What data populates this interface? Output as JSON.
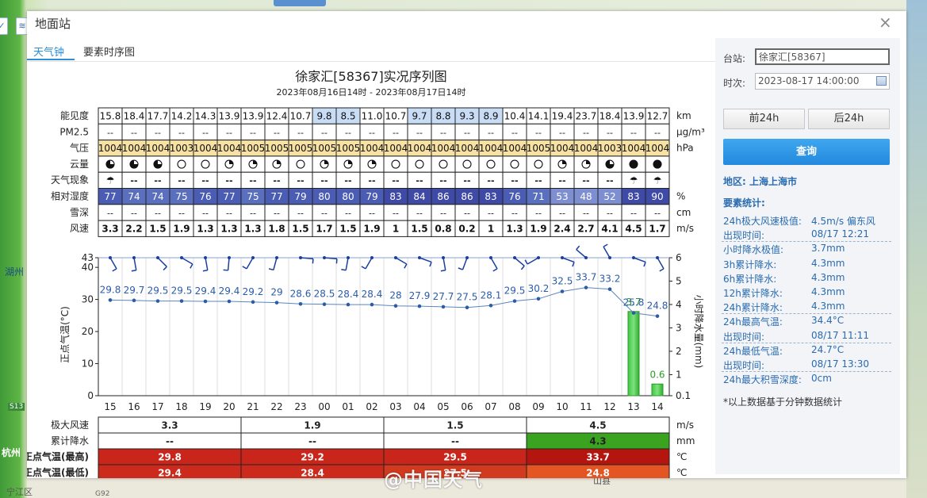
{
  "dialog": {
    "title": "地面站",
    "close": "×"
  },
  "tabs": [
    "天气钟",
    "要素时序图"
  ],
  "chart": {
    "title": "徐家汇[58367]实况序列图",
    "subtitle": "2023年08月16日14时 - 2023年08月17日14时"
  },
  "hours": [
    "15",
    "16",
    "17",
    "18",
    "19",
    "20",
    "21",
    "22",
    "23",
    "00",
    "01",
    "02",
    "03",
    "04",
    "05",
    "06",
    "07",
    "08",
    "09",
    "10",
    "11",
    "12",
    "13",
    "14"
  ],
  "rows": [
    {
      "label": "能见度",
      "unit": "km",
      "values": [
        "15.8",
        "18.4",
        "17.7",
        "14.2",
        "14.3",
        "13.9",
        "13.9",
        "12.4",
        "10.7",
        "9.8",
        "8.5",
        "11.0",
        "10.7",
        "9.7",
        "8.8",
        "9.3",
        "8.9",
        "10.4",
        "14.1",
        "19.4",
        "23.7",
        "18.4",
        "13.9",
        "12.7"
      ],
      "colors": [
        "#fff",
        "#fff",
        "#fff",
        "#fff",
        "#fff",
        "#fff",
        "#fff",
        "#fff",
        "#fff",
        "#c9dcf5",
        "#c9dcf5",
        "#fff",
        "#fff",
        "#c9dcf5",
        "#c9dcf5",
        "#c9dcf5",
        "#c9dcf5",
        "#fff",
        "#fff",
        "#fff",
        "#fff",
        "#fff",
        "#fff",
        "#fff"
      ]
    },
    {
      "label": "PM2.5",
      "unit": "μg/m³",
      "values": [
        "--",
        "--",
        "--",
        "--",
        "--",
        "--",
        "--",
        "--",
        "--",
        "--",
        "--",
        "--",
        "--",
        "--",
        "--",
        "--",
        "--",
        "--",
        "--",
        "--",
        "--",
        "--",
        "--",
        "--"
      ]
    },
    {
      "label": "气压",
      "unit": "hPa",
      "values": [
        "1004",
        "1004",
        "1004",
        "1003",
        "1004",
        "1004",
        "1005",
        "1005",
        "1005",
        "1005",
        "1005",
        "1004",
        "1004",
        "1004",
        "1004",
        "1004",
        "1004",
        "1004",
        "1005",
        "1004",
        "1004",
        "1003",
        "1004",
        "1004"
      ],
      "bg": "#f7e2a3"
    },
    {
      "label": "云量",
      "unit": "",
      "cloud": [
        3,
        3,
        3,
        0,
        0,
        1,
        1,
        1,
        0,
        1,
        1,
        1,
        0,
        0,
        0,
        0,
        0,
        0,
        0,
        1,
        1,
        3,
        4,
        4
      ]
    },
    {
      "label": "天气现象",
      "unit": "",
      "values": [
        "☂",
        "--",
        "--",
        "--",
        "--",
        "--",
        "--",
        "--",
        "--",
        "--",
        "--",
        "--",
        "--",
        "--",
        "--",
        "--",
        "--",
        "--",
        "--",
        "--",
        "--",
        "--",
        "☂",
        "☂"
      ]
    },
    {
      "label": "相对湿度",
      "unit": "%",
      "values": [
        "77",
        "74",
        "74",
        "75",
        "76",
        "77",
        "75",
        "77",
        "79",
        "80",
        "80",
        "79",
        "83",
        "84",
        "86",
        "86",
        "83",
        "76",
        "71",
        "53",
        "48",
        "52",
        "83",
        "90"
      ],
      "humidity": true
    },
    {
      "label": "雪深",
      "unit": "cm",
      "values": [
        "--",
        "--",
        "--",
        "--",
        "--",
        "--",
        "--",
        "--",
        "--",
        "--",
        "--",
        "--",
        "--",
        "--",
        "--",
        "--",
        "--",
        "--",
        "--",
        "--",
        "--",
        "--",
        "--",
        "--"
      ]
    },
    {
      "label": "风速",
      "unit": "m/s",
      "values": [
        "3.3",
        "2.2",
        "1.5",
        "1.9",
        "1.3",
        "1.3",
        "1.3",
        "1.8",
        "1.5",
        "1.7",
        "1.5",
        "1.9",
        "1",
        "1.5",
        "0.8",
        "0.2",
        "1",
        "1.3",
        "1.9",
        "2.4",
        "2.7",
        "4.1",
        "4.5",
        "1.7"
      ]
    }
  ],
  "chart_data": {
    "type": "line",
    "x": [
      "15",
      "16",
      "17",
      "18",
      "19",
      "20",
      "21",
      "22",
      "23",
      "00",
      "01",
      "02",
      "03",
      "04",
      "05",
      "06",
      "07",
      "08",
      "09",
      "10",
      "11",
      "12",
      "13",
      "14"
    ],
    "series": [
      {
        "values": [
          29.8,
          29.7,
          29.5,
          29.5,
          29.4,
          29.4,
          29.2,
          29,
          28.6,
          28.5,
          28.4,
          28.4,
          28,
          27.9,
          27.7,
          27.5,
          28.1,
          29.5,
          30.2,
          32.5,
          33.7,
          33.2,
          25.8,
          24.8
        ]
      }
    ],
    "labels": [
      "29.8",
      "29.7",
      "29.5",
      "29.5",
      "29.4",
      "29.4",
      "29.2",
      "29",
      "28.6",
      "28.5",
      "28.4",
      "28.4",
      "28",
      "27.9",
      "27.7",
      "27.5",
      "28.1",
      "29.5",
      "30.2",
      "32.5",
      "33.7",
      "33.2",
      "25.8",
      "24.8"
    ],
    "precip": [
      0,
      0,
      0,
      0,
      0,
      0,
      0,
      0,
      0,
      0,
      0,
      0,
      0,
      0,
      0,
      0,
      0,
      0,
      0,
      0,
      0,
      0,
      3.7,
      0.6
    ],
    "precip_labels": {
      "22": "3.7",
      "23": "0.6"
    },
    "wind_dir": [
      150,
      170,
      135,
      120,
      170,
      185,
      210,
      195,
      95,
      95,
      190,
      210,
      120,
      110,
      170,
      200,
      150,
      130,
      240,
      110,
      310,
      330,
      110,
      150
    ],
    "ylabel_left": "正点气温(°C)",
    "ylabel_right": "小时降水量(mm)",
    "yticks_left": [
      "43",
      "40",
      "30",
      "20",
      "10",
      "0"
    ],
    "yticks_right": [
      "6",
      "5",
      "4",
      "3",
      "2",
      "1",
      "0.1"
    ],
    "ylim_left": [
      0,
      43
    ],
    "ylim_right": [
      0.1,
      6
    ]
  },
  "summary": {
    "rows": [
      {
        "label": "极大风速",
        "unit": "m/s",
        "values": [
          "3.3",
          "1.9",
          "1.5",
          "4.5"
        ],
        "colors": [
          "#fff",
          "#fff",
          "#fff",
          "#fff"
        ],
        "textcolor": "#222"
      },
      {
        "label": "累计降水",
        "unit": "mm",
        "values": [
          "--",
          "--",
          "--",
          "4.3"
        ],
        "colors": [
          "#fff",
          "#fff",
          "#fff",
          "#3aa421"
        ],
        "textcolor": "#222"
      },
      {
        "label": "正点气温(最高)",
        "unit": "℃",
        "values": [
          "29.8",
          "29.2",
          "29.5",
          "33.7"
        ],
        "colors": [
          "#c9251a",
          "#c9251a",
          "#c9251a",
          "#b5150f"
        ],
        "textcolor": "#fff"
      },
      {
        "label": "正点气温(最低)",
        "unit": "℃",
        "values": [
          "29.4",
          "28.4",
          "27.5",
          "24.8"
        ],
        "colors": [
          "#cc2a1c",
          "#cc2a1c",
          "#d23a1f",
          "#e35523"
        ],
        "textcolor": "#fff"
      }
    ]
  },
  "side": {
    "station_label": "台站:",
    "station_value": "徐家汇[58367]",
    "time_label": "时次:",
    "time_value": "2023-08-17 14:00:00",
    "prev_btn": "前24h",
    "next_btn": "后24h",
    "query_btn": "查询",
    "area": "地区: 上海上海市",
    "section": "要素统计:",
    "stats": [
      {
        "k": "24h极大风速极值:",
        "v": "4.5m/s 偏东风"
      },
      {
        "k": "出现时间:",
        "v": "08/17 12:21",
        "sep": true
      },
      {
        "k": "小时降水极值:",
        "v": "3.7mm"
      },
      {
        "k": "3h累计降水:",
        "v": "4.3mm"
      },
      {
        "k": "6h累计降水:",
        "v": "4.3mm"
      },
      {
        "k": "12h累计降水:",
        "v": "4.3mm"
      },
      {
        "k": "24h累计降水:",
        "v": "4.3mm",
        "sep": true
      },
      {
        "k": "24h最高气温:",
        "v": "34.4°C"
      },
      {
        "k": "出现时间:",
        "v": "08/17 11:11",
        "sep": true
      },
      {
        "k": "24h最低气温:",
        "v": "24.7°C"
      },
      {
        "k": "出现时间:",
        "v": "08/17 13:30",
        "sep": true
      },
      {
        "k": "24h最大积雪深度:",
        "v": "0cm"
      }
    ],
    "note": "*以上数据基于分钟数据统计"
  },
  "watermark": "@中国天气",
  "map": {
    "labels": [
      "湖州",
      "杭州",
      "S13",
      "G92",
      "宁江区",
      "山县"
    ]
  }
}
